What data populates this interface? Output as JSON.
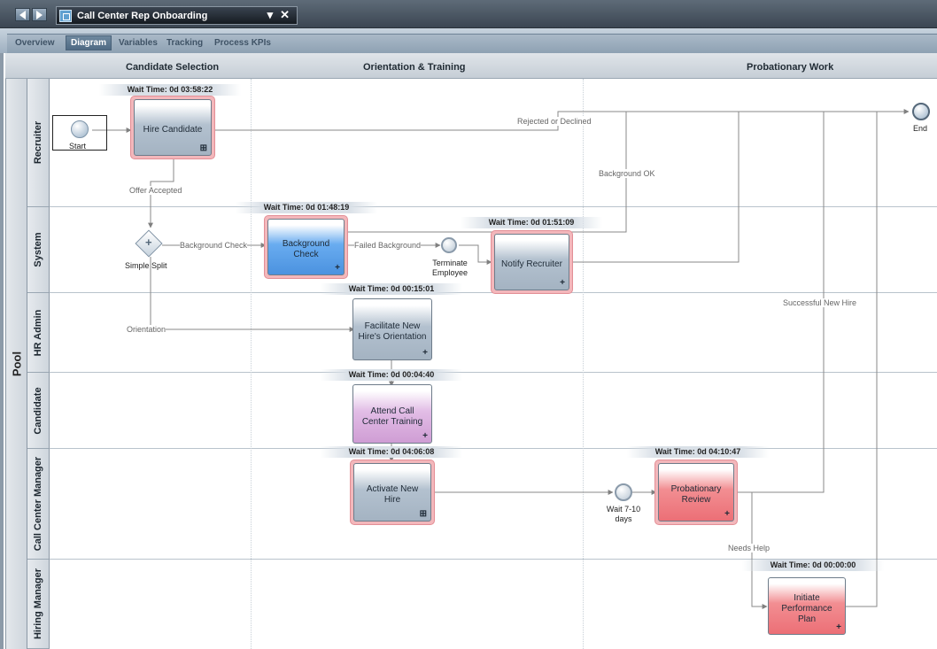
{
  "window": {
    "doc_title": "Call Center Rep Onboarding",
    "back_glyph": "◀",
    "forward_glyph": "▶",
    "dropdown_glyph": "▾",
    "close_glyph": "✕"
  },
  "tabs": [
    {
      "label": "Overview",
      "active": false
    },
    {
      "label": "Diagram",
      "active": true
    },
    {
      "label": "Variables",
      "active": false
    },
    {
      "label": "Tracking",
      "active": false
    },
    {
      "label": "Process KPIs",
      "active": false
    }
  ],
  "columns": [
    "Candidate Selection",
    "Orientation & Training",
    "Probationary Work"
  ],
  "pool_label": "Pool",
  "lanes": [
    "Recruiter",
    "System",
    "HR Admin",
    "Candidate",
    "Call Center Manager",
    "Hiring Manager"
  ],
  "events": {
    "start": "Start",
    "end": "End",
    "simple_split": "Simple Split",
    "terminate": "Terminate Employee",
    "wait_timer": "Wait 7-10 days"
  },
  "tasks": {
    "hire_candidate": {
      "label": "Hire Candidate",
      "wait": "Wait Time: 0d 03:58:22",
      "marker": "⊞"
    },
    "background_check": {
      "label": "Background Check",
      "wait": "Wait Time: 0d 01:48:19",
      "marker": "+"
    },
    "notify_recruiter": {
      "label": "Notify Recruiter",
      "wait": "Wait Time: 0d 01:51:09",
      "marker": "+"
    },
    "facilitate_orientation": {
      "label": "Facilitate New Hire's Orientation",
      "wait": "Wait Time: 0d 00:15:01",
      "marker": "+"
    },
    "attend_training": {
      "label": "Attend Call Center Training",
      "wait": "Wait Time: 0d 00:04:40",
      "marker": "+"
    },
    "activate_hire": {
      "label": "Activate New Hire",
      "wait": "Wait Time: 0d 04:06:08",
      "marker": "⊞"
    },
    "probationary_review": {
      "label": "Probationary Review",
      "wait": "Wait Time: 0d 04:10:47",
      "marker": "+"
    },
    "performance_plan": {
      "label": "Initiate Performance Plan",
      "wait": "Wait Time: 0d 00:00:00",
      "marker": "+"
    }
  },
  "flow_labels": {
    "rejected": "Rejected or Declined",
    "background_ok": "Background OK",
    "offer_accepted": "Offer Accepted",
    "background_check": "Background Check",
    "failed_background": "Failed Background",
    "orientation": "Orientation",
    "successful_hire": "Successful New Hire",
    "needs_help": "Needs Help"
  },
  "colors": {
    "highlight": "#f3b7bb",
    "task_gray": "#a4b3c2",
    "task_blue": "#4b92df",
    "task_purple": "#cf9dd4",
    "task_red": "#ec6f76",
    "flow_line": "#8a8a8a"
  }
}
